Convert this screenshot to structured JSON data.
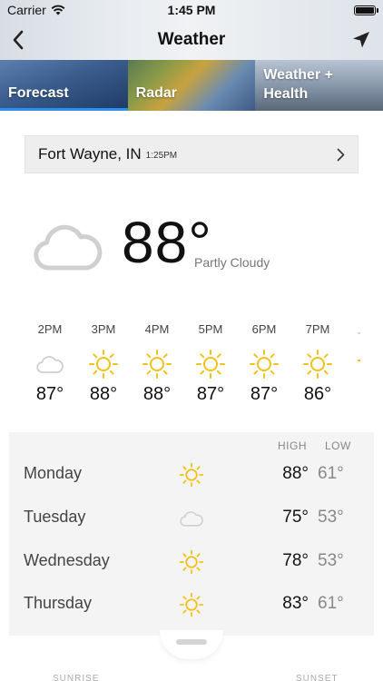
{
  "status": {
    "carrier": "Carrier",
    "time": "1:45 PM"
  },
  "nav": {
    "title": "Weather"
  },
  "tabs": [
    {
      "label": "Forecast",
      "active": true
    },
    {
      "label": "Radar",
      "active": false
    },
    {
      "label": "Weather +\nHealth",
      "active": false
    }
  ],
  "location": {
    "city": "Fort Wayne, IN",
    "updated": "1:25PM"
  },
  "current": {
    "temp": "88°",
    "condition": "Partly Cloudy",
    "icon": "cloud-icon"
  },
  "hourly": [
    {
      "time": "2PM",
      "icon": "cloud-icon",
      "temp": "87°"
    },
    {
      "time": "3PM",
      "icon": "sun-icon",
      "temp": "88°"
    },
    {
      "time": "4PM",
      "icon": "sun-icon",
      "temp": "88°"
    },
    {
      "time": "5PM",
      "icon": "sun-icon",
      "temp": "87°"
    },
    {
      "time": "6PM",
      "icon": "sun-icon",
      "temp": "87°"
    },
    {
      "time": "7PM",
      "icon": "sun-icon",
      "temp": "86°"
    }
  ],
  "daily": {
    "high_label": "HIGH",
    "low_label": "LOW",
    "days": [
      {
        "name": "Monday",
        "icon": "sun-icon",
        "high": "88°",
        "low": "61°"
      },
      {
        "name": "Tuesday",
        "icon": "cloud-icon",
        "high": "75°",
        "low": "53°"
      },
      {
        "name": "Wednesday",
        "icon": "sun-icon",
        "high": "78°",
        "low": "53°"
      },
      {
        "name": "Thursday",
        "icon": "sun-icon",
        "high": "83°",
        "low": "61°"
      }
    ]
  },
  "footer": {
    "sunrise": "SUNRISE",
    "sunset": "SUNSET"
  },
  "colors": {
    "accent": "#2e8fe8",
    "sun": "#f2c21b",
    "cloud": "#c8c8c8"
  }
}
